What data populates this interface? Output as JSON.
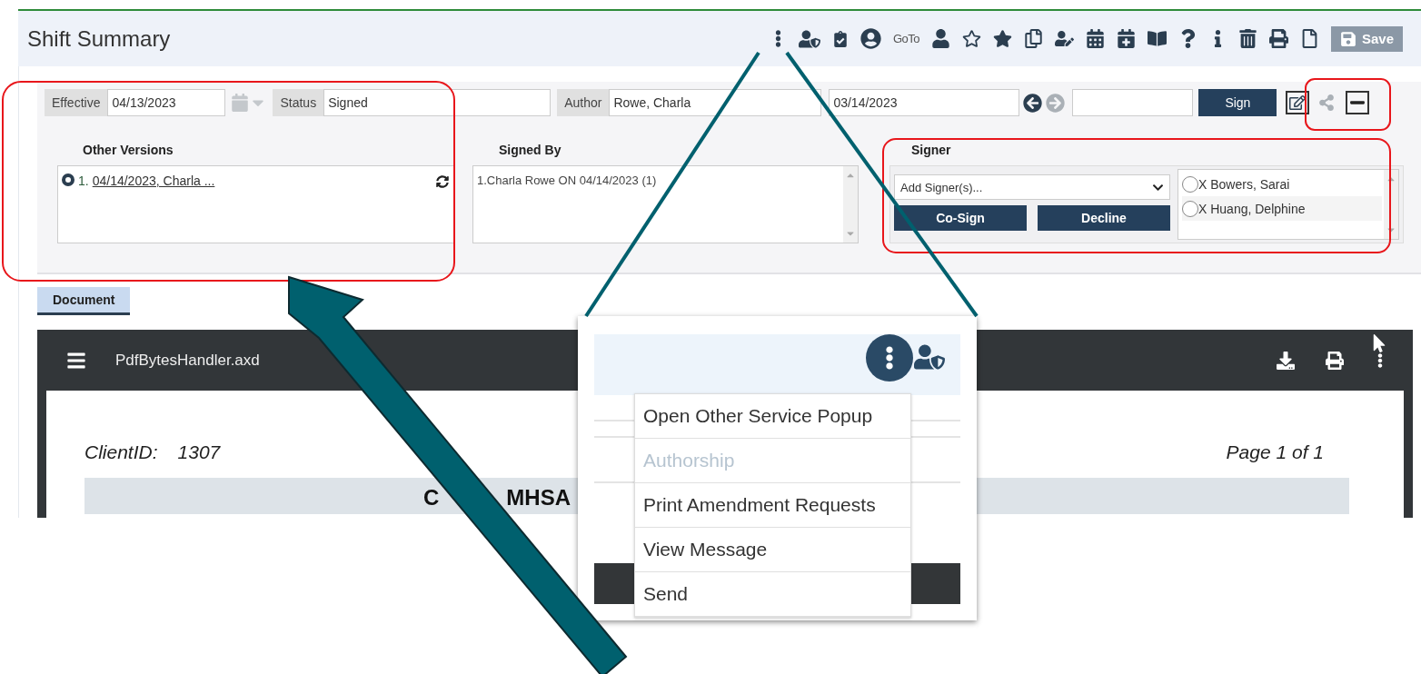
{
  "header": {
    "title": "Shift Summary",
    "goto_label": "GoTo",
    "save_label": "Save"
  },
  "fields": {
    "effective_label": "Effective",
    "effective_value": "04/13/2023",
    "status_label": "Status",
    "status_value": "Signed",
    "author_label": "Author",
    "author_value": "Rowe, Charla",
    "date_value": "03/14/2023",
    "sign_label": "Sign"
  },
  "other_versions": {
    "heading": "Other Versions",
    "items": [
      {
        "number": "1.",
        "link": "04/14/2023, Charla ...",
        "selected": true
      }
    ]
  },
  "signed_by": {
    "heading": "Signed By",
    "lines": [
      "1.Charla Rowe ON 04/14/2023 (1)"
    ]
  },
  "signer": {
    "heading": "Signer",
    "dropdown_text": "Add Signer(s)...",
    "cosign_label": "Co-Sign",
    "decline_label": "Decline",
    "signers": [
      {
        "name": "X Bowers, Sarai",
        "selected": false
      },
      {
        "name": "X Huang, Delphine",
        "selected": false
      }
    ]
  },
  "tabs": [
    {
      "label": "Document",
      "selected": true
    }
  ],
  "pdf_viewer": {
    "file_name": "PdfBytesHandler.axd",
    "client_id_label": "ClientID:",
    "client_id": "1307",
    "page_label": "Page 1 of 1",
    "heading_start": "C",
    "heading_end": "MHSA"
  },
  "zoom_popup": {
    "menu": [
      {
        "label": "Open Other Service Popup",
        "disabled": false
      },
      {
        "label": "Authorship",
        "disabled": true
      },
      {
        "label": "Print Amendment Requests",
        "disabled": false
      },
      {
        "label": "View Message",
        "disabled": false
      },
      {
        "label": "Send",
        "disabled": false
      }
    ]
  }
}
